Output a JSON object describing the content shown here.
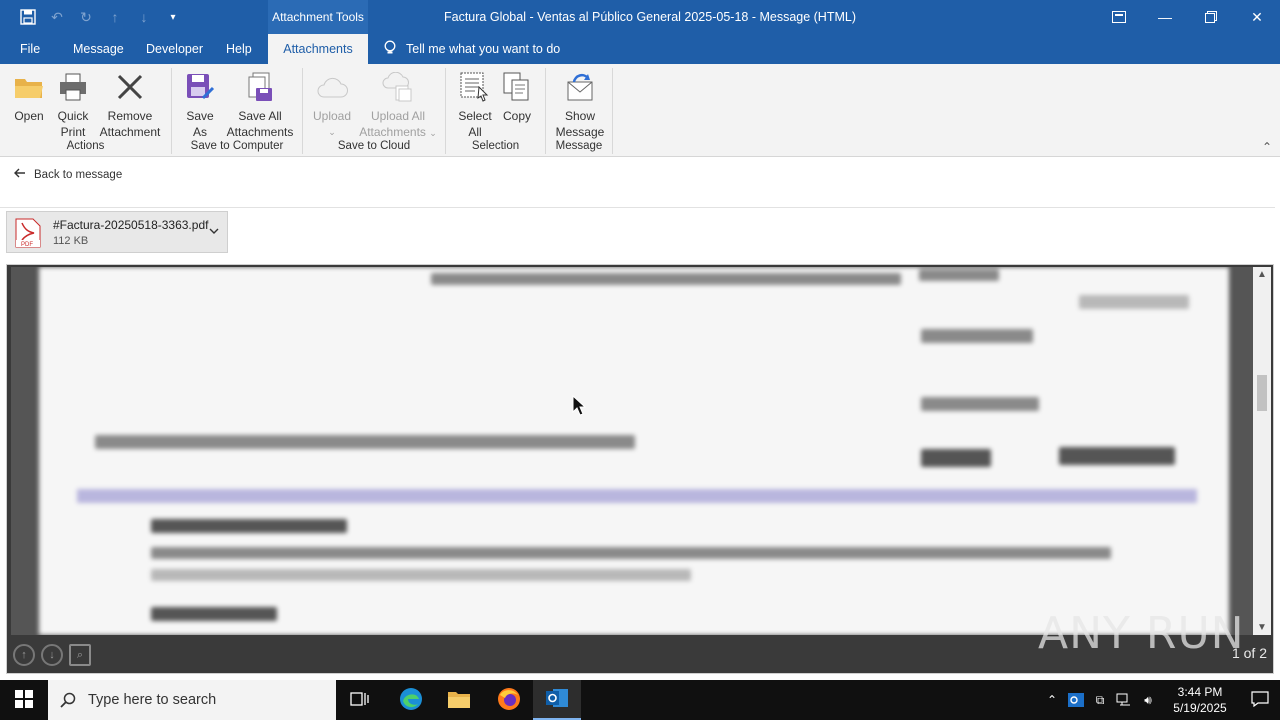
{
  "titlebar": {
    "context_tab": "Attachment Tools",
    "title": "Factura Global - Ventas al Público General 2025-05-18  -  Message (HTML)"
  },
  "tabs": [
    {
      "label": "File"
    },
    {
      "label": "Message"
    },
    {
      "label": "Developer"
    },
    {
      "label": "Help"
    },
    {
      "label": "Attachments"
    }
  ],
  "tellme": "Tell me what you want to do",
  "ribbon": {
    "groups": {
      "actions": "Actions",
      "save_computer": "Save to Computer",
      "save_cloud": "Save to Cloud",
      "selection": "Selection",
      "message": "Message"
    },
    "buttons": {
      "open": "Open",
      "quick_print_1": "Quick",
      "quick_print_2": "Print",
      "remove_1": "Remove",
      "remove_2": "Attachment",
      "save_as_1": "Save",
      "save_as_2": "As",
      "save_all_1": "Save All",
      "save_all_2": "Attachments",
      "upload": "Upload",
      "upload_all_1": "Upload All",
      "upload_all_2": "Attachments",
      "select_all_1": "Select",
      "select_all_2": "All",
      "copy": "Copy",
      "show_message_1": "Show",
      "show_message_2": "Message"
    }
  },
  "back_link": "Back to message",
  "attachment": {
    "name": "#Factura-20250518-3363.pdf",
    "size": "112 KB",
    "badge": "PDF"
  },
  "preview": {
    "page_indicator": "1 of 2",
    "watermark": "ANY RUN"
  },
  "taskbar": {
    "search_placeholder": "Type here to search",
    "time": "3:44 PM",
    "date": "5/19/2025"
  },
  "colors": {
    "title_blue": "#1f5ea8",
    "ribbon_bg": "#f3f3f3",
    "taskbar_bg": "#101010"
  }
}
